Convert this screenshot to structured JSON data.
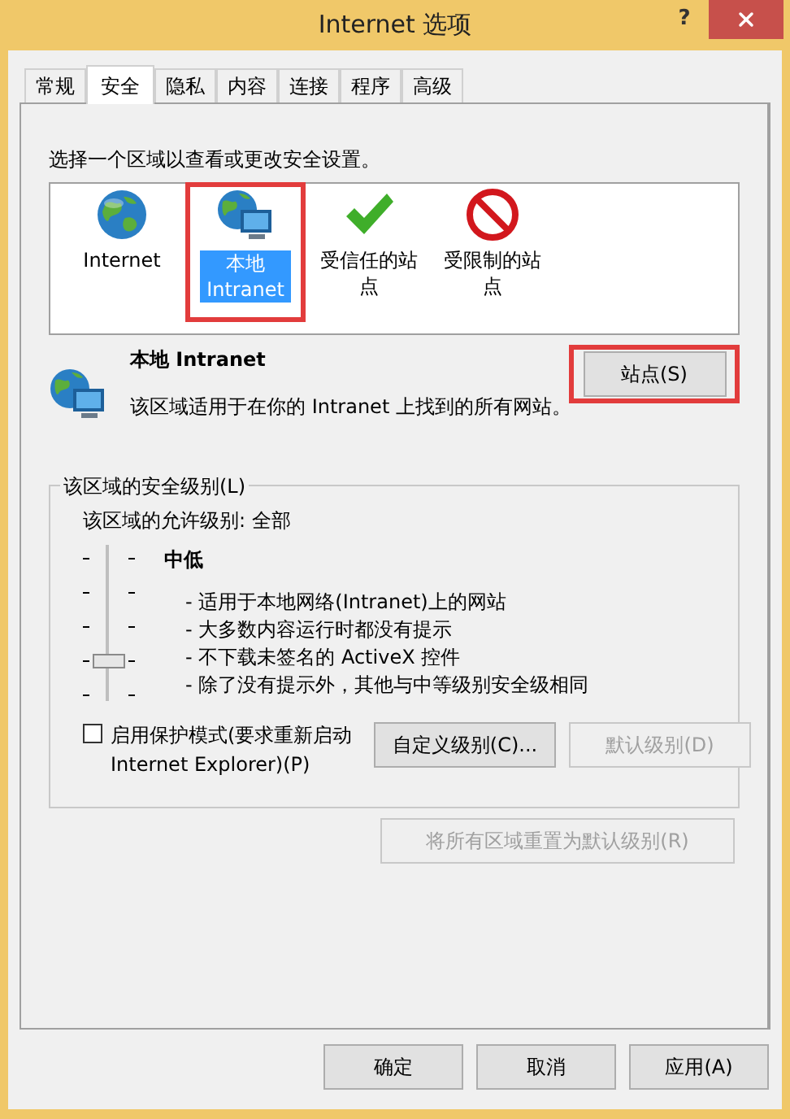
{
  "window": {
    "title": "Internet 选项",
    "help": "?"
  },
  "tabs": [
    {
      "label": "常规",
      "selected": false
    },
    {
      "label": "安全",
      "selected": true
    },
    {
      "label": "隐私",
      "selected": false
    },
    {
      "label": "内容",
      "selected": false
    },
    {
      "label": "连接",
      "selected": false
    },
    {
      "label": "程序",
      "selected": false
    },
    {
      "label": "高级",
      "selected": false
    }
  ],
  "zone_prompt": "选择一个区域以查看或更改安全设置。",
  "zones": [
    {
      "label": "Internet",
      "kind": "internet",
      "selected": false,
      "highlighted": false
    },
    {
      "label": "本地 Intranet",
      "kind": "intranet",
      "selected": true,
      "highlighted": true
    },
    {
      "label": "受信任的站点",
      "kind": "trusted",
      "selected": false,
      "highlighted": false
    },
    {
      "label": "受限制的站点",
      "kind": "restricted",
      "selected": false,
      "highlighted": false
    }
  ],
  "zone_detail": {
    "title": "本地 Intranet",
    "description": "该区域适用于在你的 Intranet 上找到的所有网站。",
    "sites_button": {
      "label": "站点(S)",
      "highlighted": true
    }
  },
  "security_level": {
    "legend": "该区域的安全级别(L)",
    "allowed": "该区域的允许级别: 全部",
    "slider": {
      "level": 0.25
    },
    "level_name": "中低",
    "bullets": [
      "- 适用于本地网络(Intranet)上的网站",
      "- 大多数内容运行时都没有提示",
      "- 不下载未签名的 ActiveX 控件",
      "- 除了没有提示外，其他与中等级别安全级相同"
    ],
    "protected_mode": {
      "label": "启用保护模式(要求重新启动 Internet Explorer)(P)",
      "checked": false
    },
    "buttons": [
      {
        "label": "自定义级别(C)...",
        "disabled": false
      },
      {
        "label": "默认级别(D)",
        "disabled": true
      }
    ]
  },
  "reset_all": {
    "label": "将所有区域重置为默认级别(R)",
    "disabled": true
  },
  "footer_buttons": [
    {
      "label": "确定"
    },
    {
      "label": "取消"
    },
    {
      "label": "应用(A)"
    }
  ]
}
